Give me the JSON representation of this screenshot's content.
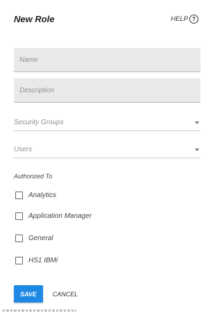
{
  "dialog": {
    "title": "New Role",
    "help_label": "HELP",
    "help_icon": "question-circle-icon"
  },
  "fields": {
    "name": {
      "placeholder": "Name",
      "value": ""
    },
    "description": {
      "placeholder": "Description",
      "value": ""
    }
  },
  "selects": {
    "security_groups": {
      "label": "Security Groups",
      "icon": "caret-down-icon"
    },
    "users": {
      "label": "Users",
      "icon": "caret-down-icon"
    }
  },
  "authorized": {
    "label": "Authorized To",
    "options": [
      {
        "label": "Analytics",
        "checked": false
      },
      {
        "label": "Application Manager",
        "checked": false
      },
      {
        "label": "General",
        "checked": false
      },
      {
        "label": "HS1 IBMi",
        "checked": false
      }
    ]
  },
  "actions": {
    "save_label": "SAVE",
    "cancel_label": "CANCEL"
  },
  "colors": {
    "accent": "#1e88e5",
    "field_bg": "#e9e9e9"
  }
}
